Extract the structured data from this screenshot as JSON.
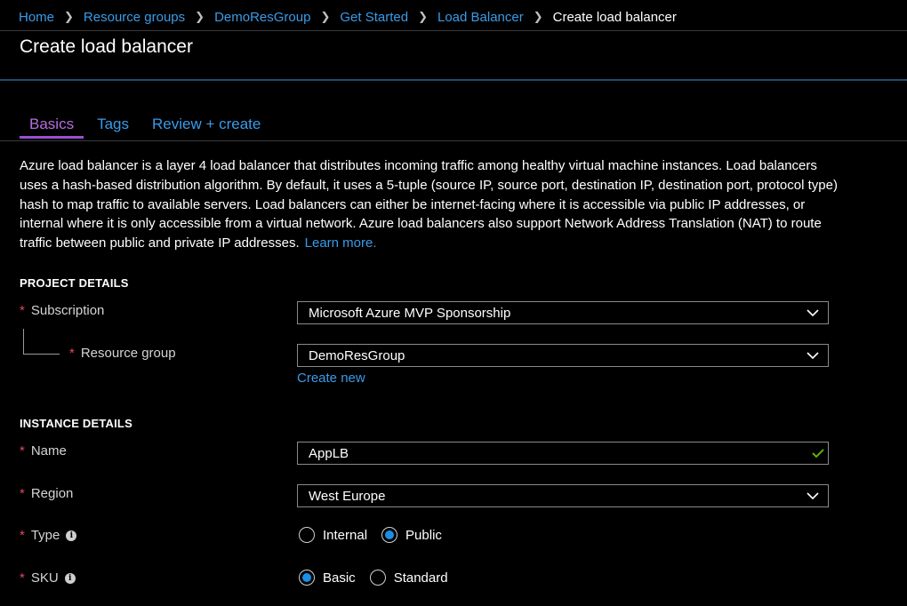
{
  "breadcrumb": {
    "items": [
      "Home",
      "Resource groups",
      "DemoResGroup",
      "Get Started",
      "Load Balancer"
    ],
    "current": "Create load balancer"
  },
  "page": {
    "title": "Create load balancer"
  },
  "tabs": [
    {
      "label": "Basics",
      "active": true
    },
    {
      "label": "Tags",
      "active": false
    },
    {
      "label": "Review + create",
      "active": false
    }
  ],
  "description": {
    "text": "Azure load balancer is a layer 4 load balancer that distributes incoming traffic among healthy virtual machine instances. Load balancers uses a hash-based distribution algorithm. By default, it uses a 5-tuple (source IP, source port, destination IP, destination port, protocol type) hash to map traffic to available servers. Load balancers can either be internet-facing where it is accessible via public IP addresses, or internal where it is only accessible from a virtual network. Azure load balancers also support Network Address Translation (NAT) to route traffic between public and private IP addresses.",
    "learn_more": "Learn more."
  },
  "project_details": {
    "heading": "PROJECT DETAILS",
    "subscription": {
      "label": "Subscription",
      "value": "Microsoft Azure  MVP Sponsorship"
    },
    "resource_group": {
      "label": "Resource group",
      "value": "DemoResGroup",
      "create_new": "Create new"
    }
  },
  "instance_details": {
    "heading": "INSTANCE DETAILS",
    "name": {
      "label": "Name",
      "value": "AppLB",
      "valid": true
    },
    "region": {
      "label": "Region",
      "value": "West Europe"
    },
    "type": {
      "label": "Type",
      "options": [
        "Internal",
        "Public"
      ],
      "selected": "Public"
    },
    "sku": {
      "label": "SKU",
      "options": [
        "Basic",
        "Standard"
      ],
      "selected": "Basic"
    }
  },
  "required_marker": "*",
  "icons": {
    "info": "info-icon",
    "chevron": "chevron-down-icon",
    "check": "checkmark-icon",
    "breadcrumb_separator": "chevron-right-icon"
  },
  "colors": {
    "link": "#3a9be8",
    "active_tab": "#b46ee0",
    "required": "#e0475e",
    "radio_selected": "#1b8fe6",
    "valid_check": "#5db300"
  }
}
